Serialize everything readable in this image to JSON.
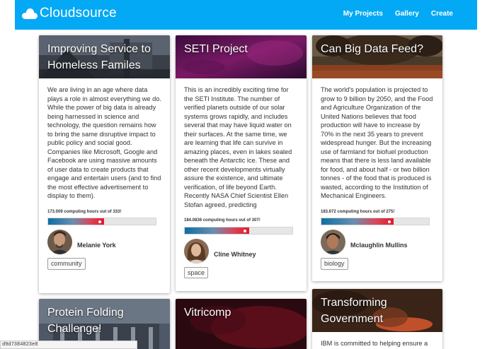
{
  "navbar": {
    "brand": "Cloudsource",
    "links": [
      "My Projects",
      "Gallery",
      "Create"
    ]
  },
  "cards": [
    {
      "title": "Improving Service to Homeless Familes",
      "description": "We are living in an age where data plays a role in almost everything we do. While the power of big data is already being harnessed in science and technology, the question remains how to bring the same disruptive impact to public policy and social good. Companies like Microsoft, Google and Facebook are using massive amounts of user data to create products that engage and entertain users (and to find the most effective advertisement to display to them).",
      "hours_text": "173.009 computing hours out of 333!",
      "progress": 0.52,
      "author": "Melanie York",
      "tag": "community"
    },
    {
      "title": "SETI Project",
      "description": "This is an incredibly exciting time for the SETI Institute. The number of verified planets outside of our solar systems grows rapidly, and includes several that may have liquid water on their surfaces. At the same time, we are learning that life can survive in amazing places, even in lakes sealed beneath the Antarctic ice. These and other recent developments virtually assure the existence, and ultimate verification, of life beyond Earth. Recently NASA Chief Scientist Ellen Stofan agreed, predicting",
      "hours_text": "184.0836 computing hours out of 307!",
      "progress": 0.6,
      "author": "Cline Whitney",
      "tag": "space"
    },
    {
      "title": "Can Big Data Feed?",
      "description": "The world's population is projected to grow to 9 billion by 2050, and the Food and Agriculture Organization of the United Nations believes that food production will have to increase by 70% in the next 35 years to prevent widespread hunger. But the increasing use of farmland for biofuel production means that there is less land available for food, and about half - or two billion tonnes - of the food that is produced is wasted, according to the Institution of Mechanical Engineers.",
      "hours_text": "183.672 computing hours out of 275!",
      "progress": 0.67,
      "author": "Mclaughlin Mullins",
      "tag": "biology"
    },
    {
      "title": "Protein Folding Challenge!"
    },
    {
      "title": "Vitricomp"
    },
    {
      "title": "Transforming Government",
      "description": "IBM is committed to helping ensure a"
    }
  ],
  "status_bar": "d9d7384823e8",
  "colors": {
    "navbar": "#03a9f4",
    "progress_start": "#0e6fa3",
    "progress_end": "#e21b2f"
  }
}
